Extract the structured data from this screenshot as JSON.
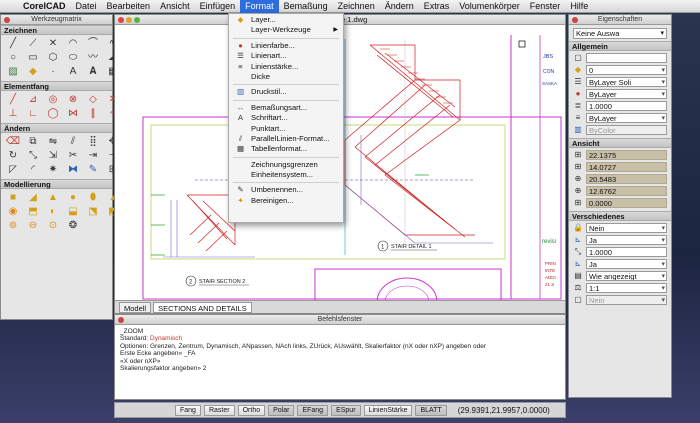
{
  "menubar": {
    "app": "CorelCAD",
    "items": [
      "Datei",
      "Bearbeiten",
      "Ansicht",
      "Einfügen",
      "Format",
      "Bemaßung",
      "Zeichnen",
      "Ändern",
      "Extras",
      "Volumenkörper",
      "Fenster",
      "Hilfe"
    ],
    "active": "Format"
  },
  "toolbox": {
    "title": "Werkzeugmatrix",
    "sections": [
      "Zeichnen",
      "Elementfang",
      "Ändern",
      "Modellierung"
    ]
  },
  "drawing": {
    "title_fragment": "e 1.dwg",
    "labels": {
      "stair_detail": "STAIR DETAIL 1",
      "stair_section": "STAIR SECTION 2",
      "revisi": "revisi",
      "jbs": "JBS",
      "con": "CON",
      "saska": "SASKA",
      "print": "PRIN",
      "inte": "INTE",
      "addi": "ADDI",
      "num": "21 S"
    },
    "tabs": [
      "Modell",
      "SECTIONS AND DETAILS"
    ],
    "active_tab": "SECTIONS AND DETAILS"
  },
  "format_menu": {
    "items": [
      {
        "label": "Layer...",
        "icon": "layers-icon"
      },
      {
        "label": "Layer-Werkzeuge",
        "submenu": true
      },
      {
        "sep": true
      },
      {
        "label": "Linienfarbe...",
        "icon": "color-wheel-icon"
      },
      {
        "label": "Linienart...",
        "icon": "linetype-icon"
      },
      {
        "label": "Linienstärke...",
        "icon": "lineweight-icon"
      },
      {
        "label": "Dicke"
      },
      {
        "sep": true
      },
      {
        "label": "Druckstil...",
        "icon": "printstyle-icon"
      },
      {
        "sep": true
      },
      {
        "label": "Bemaßungsart...",
        "icon": "dimension-style-icon"
      },
      {
        "label": "Schriftart...",
        "icon": "font-icon"
      },
      {
        "label": "Punktart..."
      },
      {
        "label": "ParallelLinien-Format...",
        "icon": "multiline-icon"
      },
      {
        "label": "Tabellenformat...",
        "icon": "table-icon"
      },
      {
        "sep": true
      },
      {
        "label": "Zeichnungsgrenzen"
      },
      {
        "label": "Einheitensystem..."
      },
      {
        "sep": true
      },
      {
        "label": "Umbenennen...",
        "icon": "rename-icon"
      },
      {
        "label": "Bereinigen...",
        "icon": "purge-icon"
      }
    ]
  },
  "properties": {
    "title": "Eigenschaften",
    "selection": "Keine Auswa",
    "sections": {
      "general": "Allgemein",
      "view": "Ansicht",
      "misc": "Verschiedenes"
    },
    "general": [
      "",
      "0",
      "ByLayer    Soli",
      "ByLayer",
      "1.0000",
      "ByLayer",
      "ByColor"
    ],
    "view": [
      "22.1375",
      "14.0727",
      "20.5483",
      "12.6762",
      "0.0000"
    ],
    "misc": [
      "Nein",
      "Ja",
      "1.0000",
      "Ja",
      "Wie angezeigt",
      "1:1",
      "Nein"
    ]
  },
  "command": {
    "title": "Befehlsfenster",
    "lines": [
      "_ZOOM",
      "Standard: Dynamisch",
      "Optionen: Grenzen, Zentrum, Dynamisch, ANpassen, NAch links, ZUrück, AUswählt, Skalierfaktor (nX oder nXP) angeben oder",
      "Erste Ecke angeben» _FA",
      "«X oder nXP»",
      "Skalierungsfaktor angeben» 2"
    ],
    "highlight": "Dynamisch"
  },
  "status": {
    "buttons": [
      "Fang",
      "Raster",
      "Ortho",
      "Polar",
      "EFang",
      "ESpur",
      "LinienStärke",
      "BLATT"
    ],
    "coords": "(29.9391,21.9957,0.0000)"
  }
}
